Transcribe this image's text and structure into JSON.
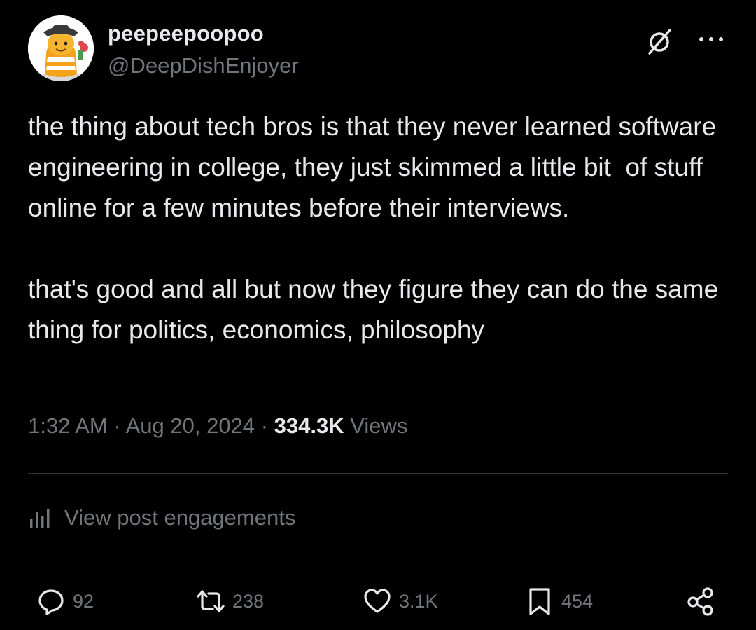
{
  "post": {
    "author": {
      "display_name": "peepeepoopoo",
      "handle": "@DeepDishEnjoyer"
    },
    "text_paragraphs": [
      "the thing about tech bros is that they never learned software engineering in college, they just skimmed a little bit  of stuff online for a few minutes before their interviews.",
      "that's good and all but now they figure they can do the same thing for politics, economics, philosophy"
    ],
    "time": "1:32 AM",
    "separator": "·",
    "date": "Aug 20, 2024",
    "views_count": "334.3K",
    "views_label": "Views",
    "engagements_label": "View post engagements",
    "actions": {
      "replies": "92",
      "reposts": "238",
      "likes": "3.1K",
      "bookmarks": "454"
    }
  },
  "icons": {
    "avatar": "avatar-image",
    "grok": "grok-icon",
    "more": "more-icon",
    "engagements": "analytics-icon",
    "reply": "reply-icon",
    "repost": "repost-icon",
    "like": "heart-icon",
    "bookmark": "bookmark-icon",
    "share": "share-icon"
  },
  "colors": {
    "background": "#000000",
    "primary_text": "#e7e9ea",
    "secondary_text": "#71767b",
    "divider": "#2f3336"
  }
}
